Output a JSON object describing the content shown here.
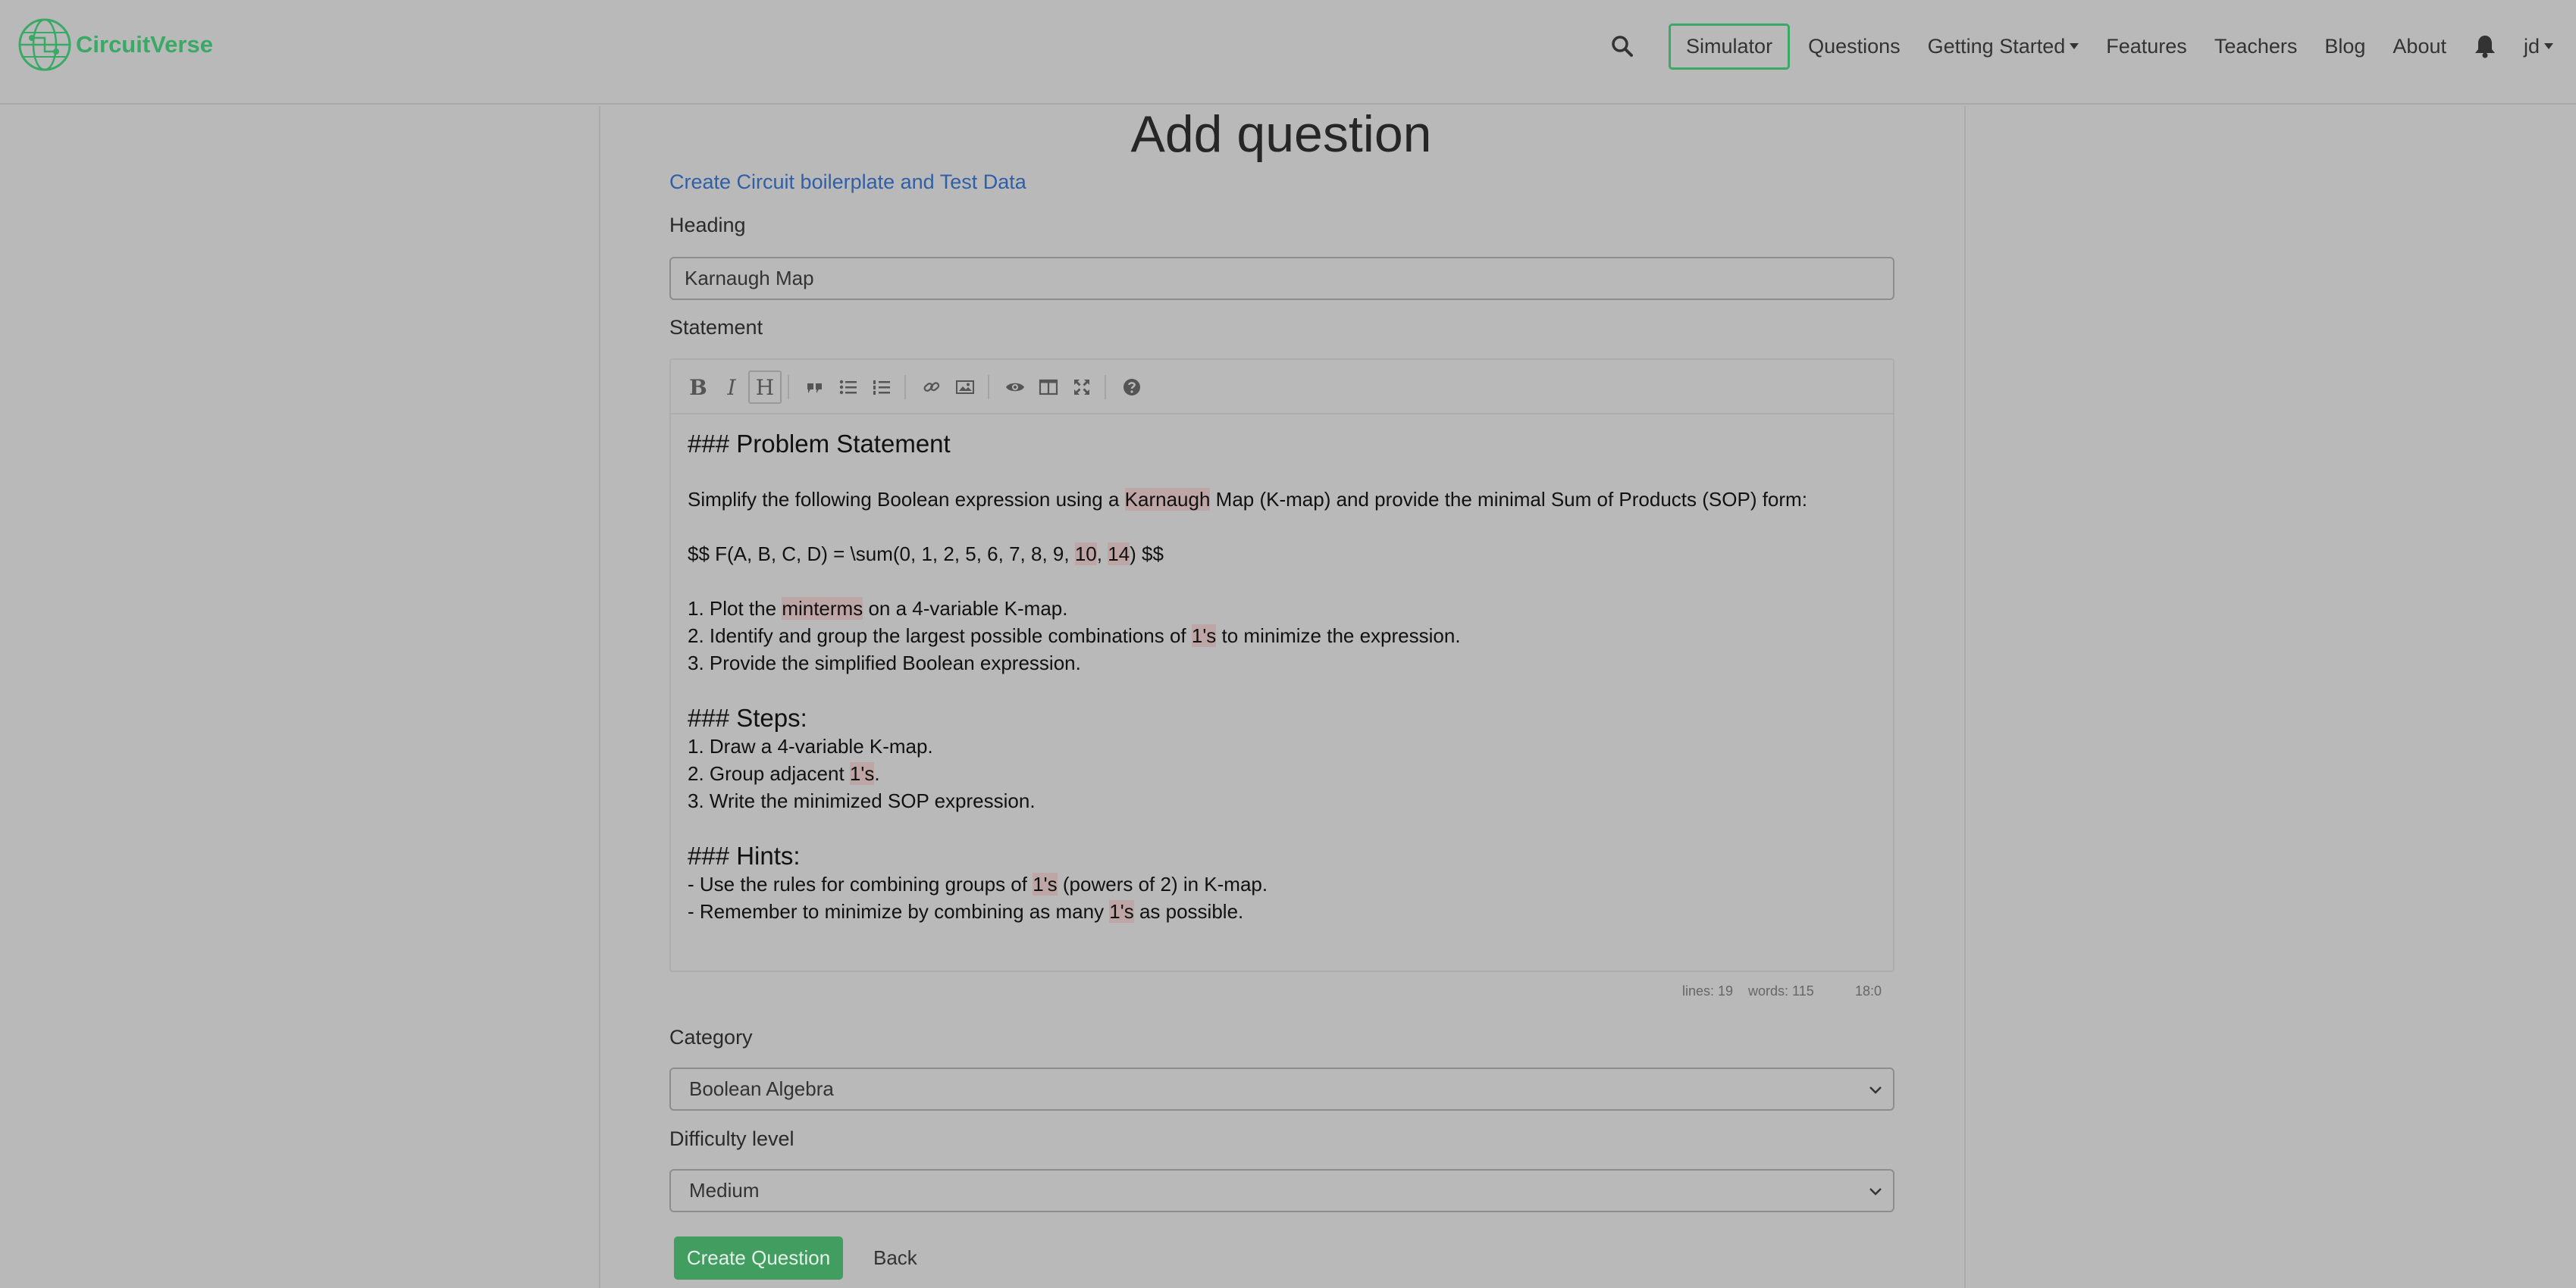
{
  "navbar": {
    "brand_name": "CircuitVerse",
    "items": {
      "simulator": "Simulator",
      "questions": "Questions",
      "getting_started": "Getting Started",
      "features": "Features",
      "teachers": "Teachers",
      "blog": "Blog",
      "about": "About",
      "user": "jd"
    },
    "icons": [
      "search-icon",
      "bell-icon",
      "caret-down-icon"
    ]
  },
  "page": {
    "title": "Add question",
    "boilerplate_link": "Create Circuit boilerplate and Test Data",
    "heading_label": "Heading",
    "heading_value": "Karnaugh Map",
    "statement_label": "Statement",
    "category_label": "Category",
    "category_value": "Boolean Algebra",
    "difficulty_label": "Difficulty level",
    "difficulty_value": "Medium",
    "create_button": "Create Question",
    "back_link": "Back"
  },
  "editor": {
    "toolbar": [
      "bold",
      "italic",
      "heading",
      "quote",
      "unordered-list",
      "ordered-list",
      "link",
      "image",
      "preview",
      "side-by-side",
      "fullscreen",
      "guide"
    ],
    "lines": {
      "l1": "### Problem Statement",
      "l2_a": "Simplify the following Boolean expression using a ",
      "l2_hl": "Karnaugh",
      "l2_b": " Map (K-map) and provide the minimal Sum of Products (SOP) form:",
      "l3_a": "$$ F(A, B, C, D) = \\sum(0, 1, 2, 5, 6, 7, 8, 9, ",
      "l3_hl1": "10",
      "l3_b": ", ",
      "l3_hl2": "14",
      "l3_c": ") $$",
      "l4_a": "1. Plot the ",
      "l4_hl": "minterms",
      "l4_b": " on a 4-variable K-map.",
      "l5_a": "2. Identify and group the largest possible combinations of ",
      "l5_hl": "1's",
      "l5_b": " to minimize the expression.",
      "l6": "3. Provide the simplified Boolean expression.",
      "l7": "### Steps:",
      "l8": "1. Draw a 4-variable K-map.",
      "l9_a": "2. Group adjacent ",
      "l9_hl": "1's",
      "l9_b": ".",
      "l10": "3. Write the minimized SOP expression.",
      "l11": "### Hints:",
      "l12_a": "- Use the rules for combining groups of ",
      "l12_hl": "1's",
      "l12_b": " (powers of 2) in K-map.",
      "l13_a": "- Remember to minimize by combining as many ",
      "l13_hl": "1's",
      "l13_b": " as possible."
    },
    "status": {
      "lines": "lines: 19",
      "words": "words: 115",
      "cursor": "18:0"
    }
  },
  "colors": {
    "background": "#b9b9b9",
    "brand_green": "#3aa966",
    "button_green": "#419e60",
    "link_blue": "#2f5fa6"
  }
}
